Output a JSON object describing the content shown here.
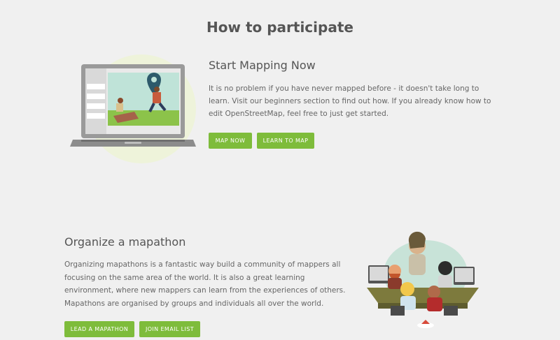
{
  "page": {
    "title": "How to participate"
  },
  "start_mapping": {
    "heading": "Start Mapping Now",
    "text": "It is no problem if you have never mapped before - it doesn't take long to learn. Visit our beginners section to find out how. If you already know how to edit OpenStreetMap, feel free to just get started.",
    "buttons": {
      "map_now": "MAP NOW",
      "learn_to_map": "LEARN TO MAP"
    },
    "illustration": "laptop-mapping-illustration"
  },
  "mapathon": {
    "heading": "Organize a mapathon",
    "text": "Organizing mapathons is a fantastic way build a community of mappers all focusing on the same area of the world. It is also a great learning environment, where new mappers can learn from the experiences of others. Mapathons are organised by groups and individuals all over the world.",
    "buttons": {
      "lead": "LEAD A MAPATHON",
      "join": "JOIN EMAIL LIST"
    },
    "illustration": "mapathon-group-illustration"
  },
  "colors": {
    "background": "#f0f0f0",
    "button": "#7ebc3b",
    "text": "#555555"
  }
}
